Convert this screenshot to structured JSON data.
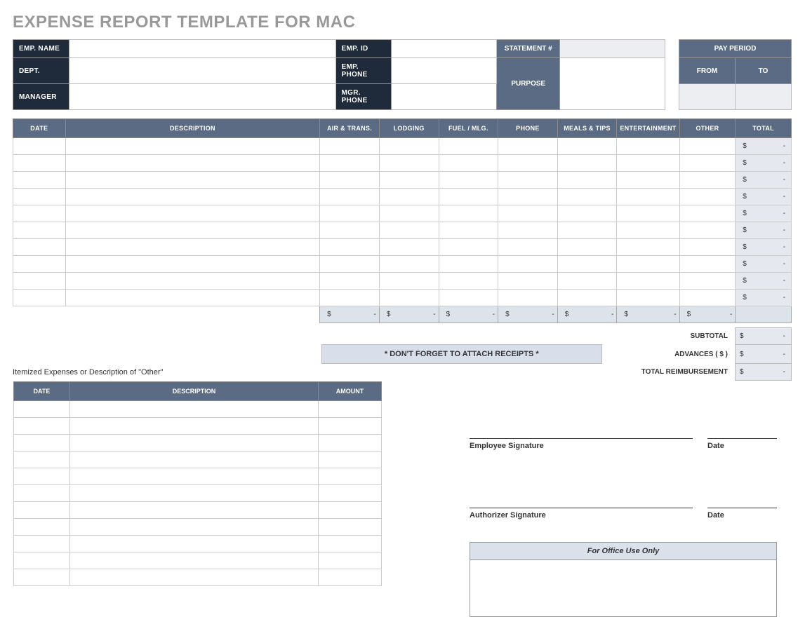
{
  "title": "EXPENSE REPORT TEMPLATE FOR MAC",
  "info": {
    "emp_name_label": "EMP. NAME",
    "emp_id_label": "EMP. ID",
    "statement_label": "STATEMENT #",
    "pay_period_label": "PAY PERIOD",
    "dept_label": "DEPT.",
    "emp_phone_label": "EMP. PHONE",
    "purpose_label": "PURPOSE",
    "from_label": "FROM",
    "to_label": "TO",
    "manager_label": "MANAGER",
    "mgr_phone_label": "MGR. PHONE"
  },
  "expense_table": {
    "headers": [
      "DATE",
      "DESCRIPTION",
      "AIR & TRANS.",
      "LODGING",
      "FUEL / MLG.",
      "PHONE",
      "MEALS & TIPS",
      "ENTERTAINMENT",
      "OTHER",
      "TOTAL"
    ],
    "row_count": 10,
    "row_total_display": "$        -",
    "col_subtotal_display": "$            -"
  },
  "receipts_note": "* DON'T FORGET TO ATTACH RECEIPTS *",
  "summary": {
    "subtotal_label": "SUBTOTAL",
    "subtotal_val": "$        -",
    "advances_label": "ADVANCES  ( $ )",
    "advances_val": "$        -",
    "reimbursement_label": "TOTAL REIMBURSEMENT",
    "reimbursement_val": "$        -"
  },
  "itemized": {
    "note": "Itemized Expenses or Description of \"Other\"",
    "headers": [
      "DATE",
      "DESCRIPTION",
      "AMOUNT"
    ],
    "row_count": 11
  },
  "signatures": {
    "employee_label": "Employee Signature",
    "authorizer_label": "Authorizer Signature",
    "date_label": "Date"
  },
  "office": {
    "header": "For Office Use Only"
  }
}
